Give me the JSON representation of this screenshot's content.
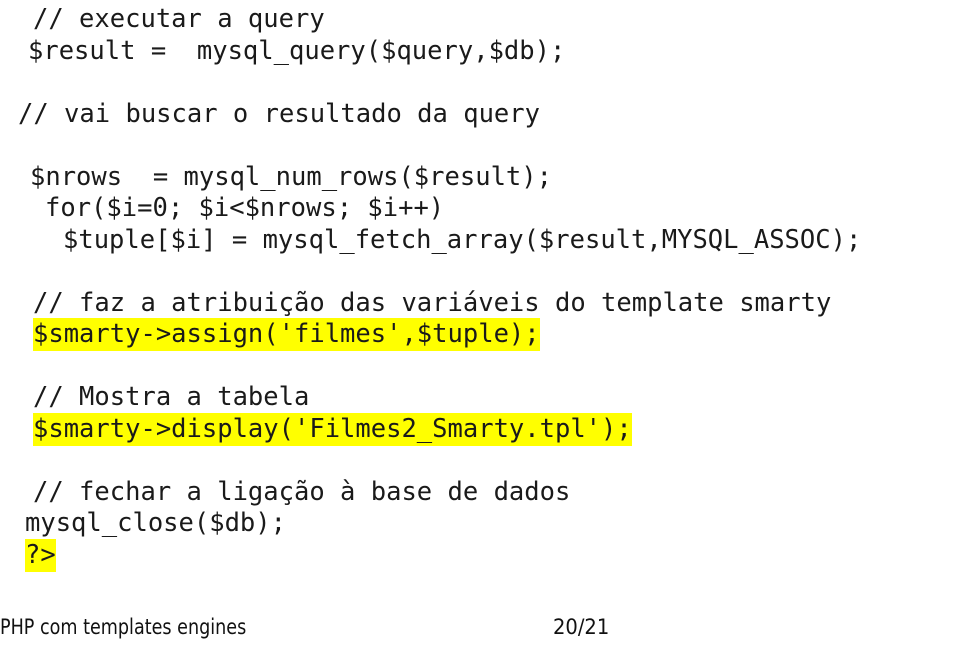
{
  "slide": {
    "background_color": "#FFFFFF",
    "highlight_color": "#FFFF00",
    "text_color": "#1A1A1A",
    "language": "php"
  },
  "code": {
    "lines": [
      {
        "indent": 2,
        "text": "// executar a query",
        "highlight": false
      },
      {
        "indent": 1,
        "text": "$result =  mysql_query($query,$db);",
        "highlight": false
      },
      {
        "indent": 0,
        "text": "",
        "highlight": false
      },
      {
        "indent": 0,
        "text": "// vai buscar o resultado da query",
        "highlight": false
      },
      {
        "indent": 0,
        "text": "",
        "highlight": false
      },
      {
        "indent": 3,
        "text": "$nrows  = mysql_num_rows($result);",
        "highlight": false
      },
      {
        "indent": 4,
        "text": "for($i=0; $i<$nrows; $i++)",
        "highlight": false
      },
      {
        "indent": 5,
        "text": "$tuple[$i] = mysql_fetch_array($result,MYSQL_ASSOC);",
        "highlight": false
      },
      {
        "indent": 0,
        "text": "",
        "highlight": false
      },
      {
        "indent": 2,
        "text": "// faz a atribuição das variáveis do template smarty",
        "highlight": false
      },
      {
        "indent": 2,
        "text": "$smarty->assign('filmes',$tuple);",
        "highlight": true
      },
      {
        "indent": 0,
        "text": "",
        "highlight": false
      },
      {
        "indent": 2,
        "text": "// Mostra a tabela",
        "highlight": false
      },
      {
        "indent": 2,
        "text": "$smarty->display('Filmes2_Smarty.tpl');",
        "highlight": true
      },
      {
        "indent": 0,
        "text": "",
        "highlight": false
      },
      {
        "indent": 2,
        "text": "// fechar a ligação à base de dados",
        "highlight": false
      },
      {
        "indent": 6,
        "text": "mysql_close($db);",
        "highlight": false
      },
      {
        "indent": 6,
        "text": "?>",
        "highlight": true
      }
    ]
  },
  "footer": {
    "title": "PHP com templates engines",
    "page_label": "20/21",
    "current_page": 20,
    "total_pages": 21
  }
}
